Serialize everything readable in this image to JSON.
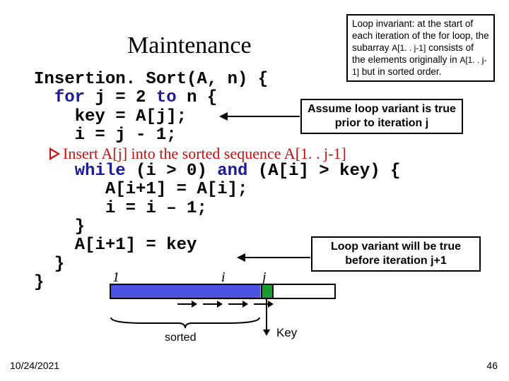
{
  "title": "Maintenance",
  "invariant_box": {
    "line1": "Loop invariant: at the start of each iteration of the for loop, the subarray ",
    "small1": "A[1. . j-1]",
    "line2": " consists of the elements originally in ",
    "small2": "A[1. . j-1]",
    "line3": " but in sorted order."
  },
  "assume_box": {
    "line1": "Assume loop variant is true",
    "line2": "prior to iteration j"
  },
  "true_box": {
    "line1": "Loop variant will be true",
    "line2": "before iteration j+1"
  },
  "code": {
    "l1a": "Insertion. Sort(A, n) {",
    "l2a": "  ",
    "l2kw": "for",
    "l2b": " j = 2 ",
    "l2kw2": "to",
    "l2c": " n {",
    "l3": "    key = A[j];",
    "l4": "    i = j - 1;",
    "comment": "Insert A[j] into the sorted sequence A[1. . j-1]",
    "l5a": "    ",
    "l5kw": "while",
    "l5b": " (i > 0) ",
    "l5kw2": "and",
    "l5c": " (A[i] > key) {",
    "l6": "       A[i+1] = A[i];",
    "l7": "       i = i – 1;",
    "l8": "    }",
    "l9": "    A[i+1] = key",
    "l10": "  }",
    "l11": "}"
  },
  "diagram": {
    "label_1": "1",
    "label_i": "i",
    "label_j": "j",
    "sorted": "sorted",
    "key": "Key"
  },
  "footer": {
    "date": "10/24/2021",
    "slide": "46"
  }
}
